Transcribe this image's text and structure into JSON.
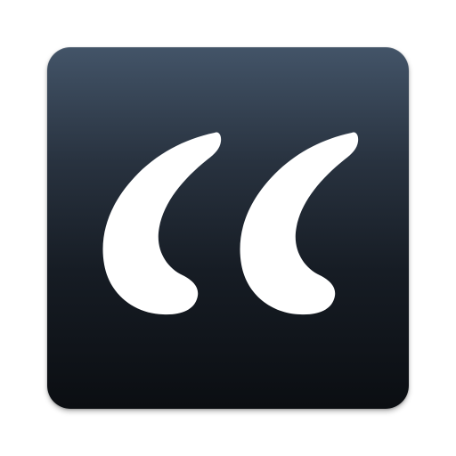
{
  "app_icon": {
    "icon": "quotation-marks-icon",
    "background_top": "#435468",
    "background_bottom": "#0b0e12",
    "glyph_color": "#ffffff"
  }
}
